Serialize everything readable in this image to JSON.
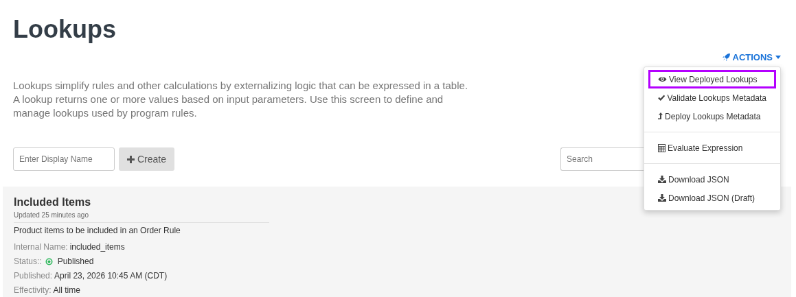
{
  "page": {
    "title": "Lookups",
    "description": [
      "Lookups simplify rules and other calculations by externalizing logic that can be expressed in a table.",
      "A lookup returns one or more values based on input parameters. Use this screen to define and",
      "manage lookups used by program rules."
    ]
  },
  "actions": {
    "label": "ACTIONS",
    "expanded": true,
    "groups": [
      [
        {
          "label": "View Deployed Lookups",
          "selected": true
        },
        {
          "label": "Validate Lookups Metadata",
          "selected": false
        },
        {
          "label": "Deploy Lookups Metadata",
          "selected": false
        }
      ],
      [
        {
          "label": "Evaluate Expression",
          "selected": false
        }
      ],
      [
        {
          "label": "Download JSON",
          "selected": false
        },
        {
          "label": "Download JSON (Draft)",
          "selected": false
        }
      ]
    ]
  },
  "create": {
    "placeholder": "Enter Display Name",
    "button": "Create"
  },
  "search": {
    "placeholder": "Search"
  },
  "lookups": [
    {
      "name": "Included Items",
      "updated": "Updated 25 minutes ago",
      "description": "Product items to be included in an Order Rule",
      "fields": [
        {
          "label": "Internal Name:",
          "value": "included_items"
        },
        {
          "label": "Status::",
          "value": "Published",
          "color": "#2eb85c"
        },
        {
          "label": "Published:",
          "value": "April 23, 2026 10:45 AM (CDT)"
        },
        {
          "label": "Effectivity:",
          "value": "All time"
        }
      ]
    }
  ]
}
